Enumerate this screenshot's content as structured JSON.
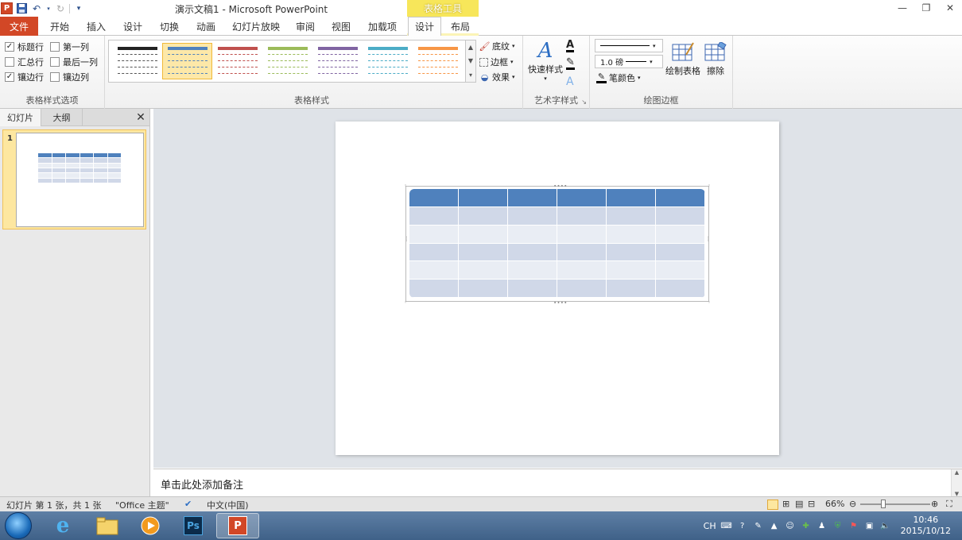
{
  "titlebar": {
    "title": "演示文稿1 - Microsoft PowerPoint",
    "context_tab_title": "表格工具",
    "app_logo": "P"
  },
  "tabs": [
    {
      "label": "文件"
    },
    {
      "label": "开始"
    },
    {
      "label": "插入"
    },
    {
      "label": "设计"
    },
    {
      "label": "切换"
    },
    {
      "label": "动画"
    },
    {
      "label": "幻灯片放映"
    },
    {
      "label": "审阅"
    },
    {
      "label": "视图"
    },
    {
      "label": "加载项"
    },
    {
      "label": "设计"
    },
    {
      "label": "布局"
    }
  ],
  "ribbon": {
    "style_options": {
      "group_label": "表格样式选项",
      "checkboxes": [
        {
          "label": "标题行",
          "checked": true
        },
        {
          "label": "第一列",
          "checked": false
        },
        {
          "label": "汇总行",
          "checked": false
        },
        {
          "label": "最后一列",
          "checked": false
        },
        {
          "label": "镶边行",
          "checked": true
        },
        {
          "label": "镶边列",
          "checked": false
        }
      ]
    },
    "table_styles": {
      "group_label": "表格样式",
      "style_colors": [
        "#222222",
        "#4f81bd",
        "#c0504d",
        "#9bbb59",
        "#8064a2",
        "#4bacc6",
        "#f79646"
      ],
      "shading_label": "底纹",
      "border_label": "边框",
      "effects_label": "效果"
    },
    "wordart": {
      "group_label": "艺术字样式",
      "quick_styles_label": "快速样式"
    },
    "draw_borders": {
      "group_label": "绘图边框",
      "pen_weight": "1.0 磅",
      "pen_color_label": "笔颜色",
      "draw_table_label": "绘制表格",
      "eraser_label": "擦除"
    }
  },
  "left_pane": {
    "tab_slides": "幻灯片",
    "tab_outline": "大纲",
    "slide_number": "1"
  },
  "notes": {
    "placeholder": "单击此处添加备注"
  },
  "statusbar": {
    "slide_info": "幻灯片 第 1 张，共 1 张",
    "theme": "\"Office 主题\"",
    "language": "中文(中国)",
    "zoom": "66%"
  },
  "taskbar": {
    "tray_lang": "CH",
    "time": "10:46",
    "date": "2015/10/12"
  },
  "table": {
    "header_color": "#4f81bd",
    "band_dark": "#d0d8e8",
    "band_light": "#e9edf4",
    "rows": 6,
    "cols": 6
  }
}
